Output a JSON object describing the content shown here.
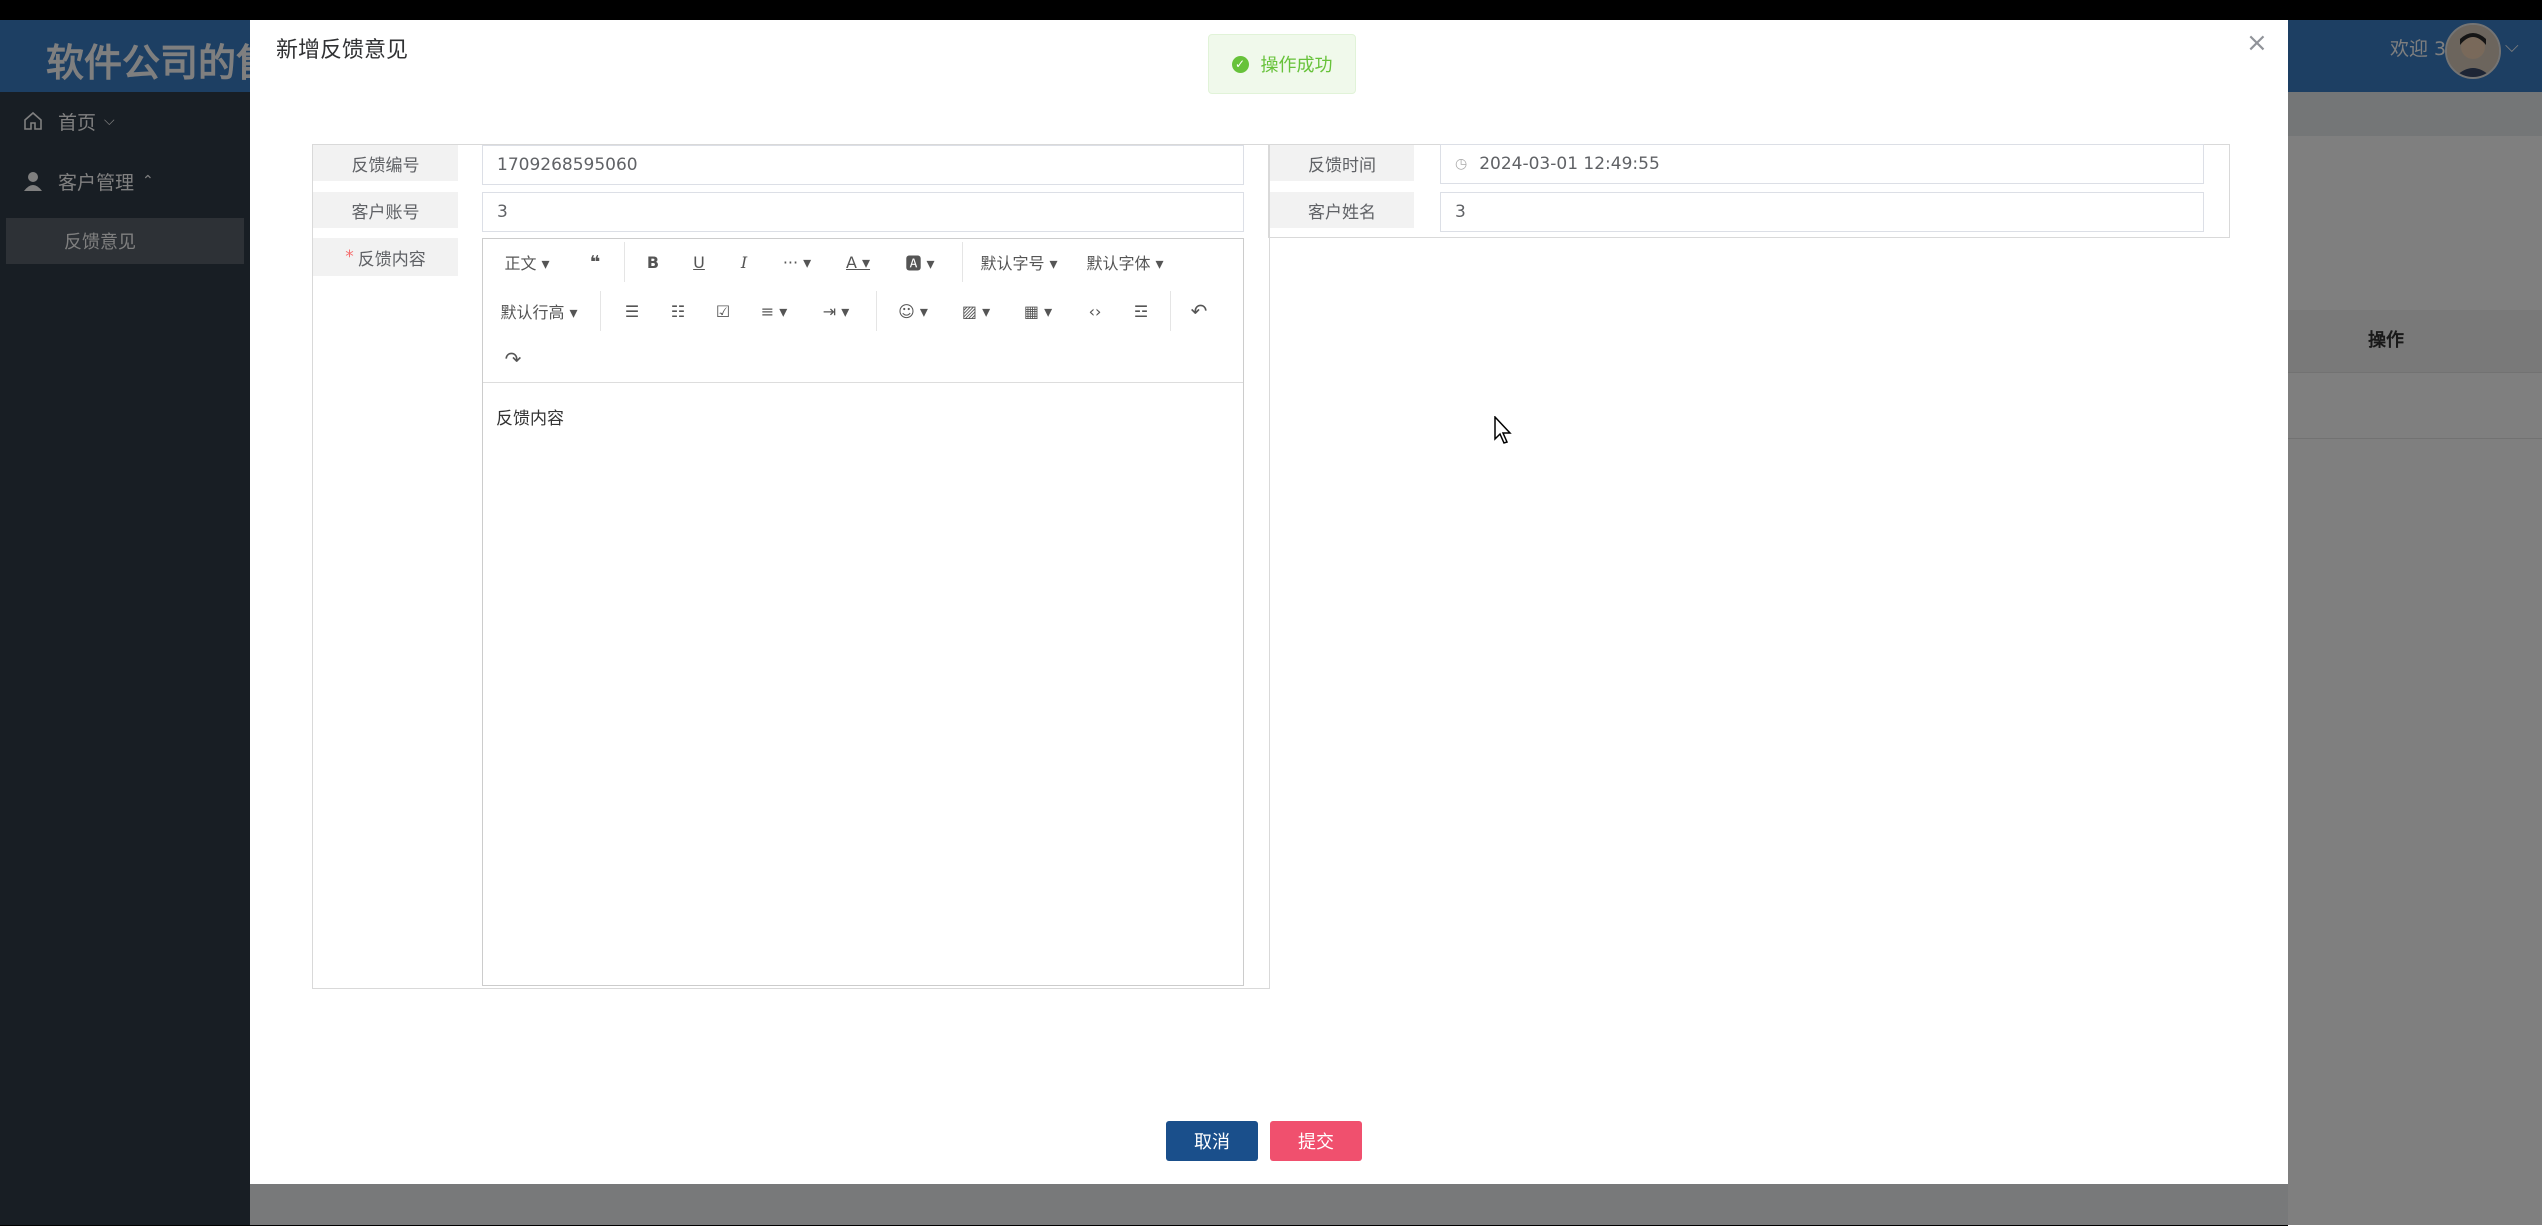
{
  "app": {
    "title": "软件公司的售",
    "welcome": "欢迎 3",
    "user_caret": "⌵"
  },
  "sidebar": {
    "items": [
      {
        "label": "首页",
        "icon": "home-icon",
        "caret": "⌵"
      },
      {
        "label": "客户管理",
        "icon": "user-icon",
        "caret": "⌃"
      }
    ],
    "sub_items": [
      {
        "label": "反馈意见"
      }
    ]
  },
  "background_table": {
    "operation_header": "操作"
  },
  "dialog": {
    "title": "新增反馈意见",
    "close": "×"
  },
  "toast": {
    "message": "操作成功",
    "color": "#67c23a"
  },
  "form": {
    "feedback_no_label": "反馈编号",
    "feedback_no_value": "1709268595060",
    "feedback_time_label": "反馈时间",
    "feedback_time_value": "2024-03-01 12:49:55",
    "customer_account_label": "客户账号",
    "customer_account_value": "3",
    "customer_name_label": "客户姓名",
    "customer_name_value": "3",
    "content_label": "反馈内容",
    "required_mark": "*",
    "content_value": "反馈内容"
  },
  "editor_toolbar": {
    "row1": [
      {
        "name": "heading-dropdown",
        "label": "正文 ▾"
      },
      {
        "name": "quote-icon",
        "label": "❝"
      },
      {
        "name": "bold-icon",
        "label": "B"
      },
      {
        "name": "underline-icon",
        "label": "U"
      },
      {
        "name": "italic-icon",
        "label": "I"
      },
      {
        "name": "more-icon",
        "label": "··· ▾"
      },
      {
        "name": "font-color-icon",
        "label": "A ▾"
      },
      {
        "name": "bg-color-icon",
        "label": "🅰 ▾"
      },
      {
        "name": "font-size-dropdown",
        "label": "默认字号 ▾"
      },
      {
        "name": "font-family-dropdown",
        "label": "默认字体 ▾"
      }
    ],
    "row2": [
      {
        "name": "line-height-dropdown",
        "label": "默认行高 ▾"
      },
      {
        "name": "bullet-list-icon",
        "label": "☰"
      },
      {
        "name": "numbered-list-icon",
        "label": "☷"
      },
      {
        "name": "todo-icon",
        "label": "☑"
      },
      {
        "name": "align-icon",
        "label": "≡ ▾"
      },
      {
        "name": "indent-icon",
        "label": "⇥ ▾"
      },
      {
        "name": "emoji-icon",
        "label": "☺ ▾"
      },
      {
        "name": "image-icon",
        "label": "▨ ▾"
      },
      {
        "name": "table-icon",
        "label": "▦ ▾"
      },
      {
        "name": "code-icon",
        "label": "‹›"
      },
      {
        "name": "divider-icon",
        "label": "☲"
      },
      {
        "name": "undo-icon",
        "label": "↶"
      }
    ],
    "row3": [
      {
        "name": "redo-icon",
        "label": "↷"
      }
    ]
  },
  "buttons": {
    "cancel": "取消",
    "submit": "提交",
    "cancel_color": "#1a4f8b",
    "submit_color": "#f0506e"
  }
}
